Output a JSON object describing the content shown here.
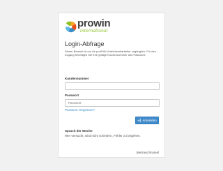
{
  "brand": {
    "name": "prowin",
    "subtitle": "international",
    "colors": {
      "green": "#8cbe1e",
      "orange": "#f5a623",
      "blue": "#3a8ec7",
      "gray": "#404040"
    }
  },
  "login": {
    "title": "Login-Abfrage",
    "intro": "Dieser Bereich ist nur für proWIN-Vertriebsmitarbeiter zugänglich. Für den Zugang benötigen Sie Ihre gültige Kundennummer und Passwort.",
    "customer_label": "Kundennummer",
    "customer_value": "",
    "password_label": "Passwort",
    "password_placeholder": "Passwort",
    "forgot_link": "Passwort vergessen?",
    "submit_label": "Anmelden",
    "submit_icon": "sign-in-icon"
  },
  "quote": {
    "heading": "Spruch der Woche",
    "text": "Wer versucht, wird nicht scheitern, Fehler zu begehen.",
    "author": "Bertrand Russel"
  }
}
